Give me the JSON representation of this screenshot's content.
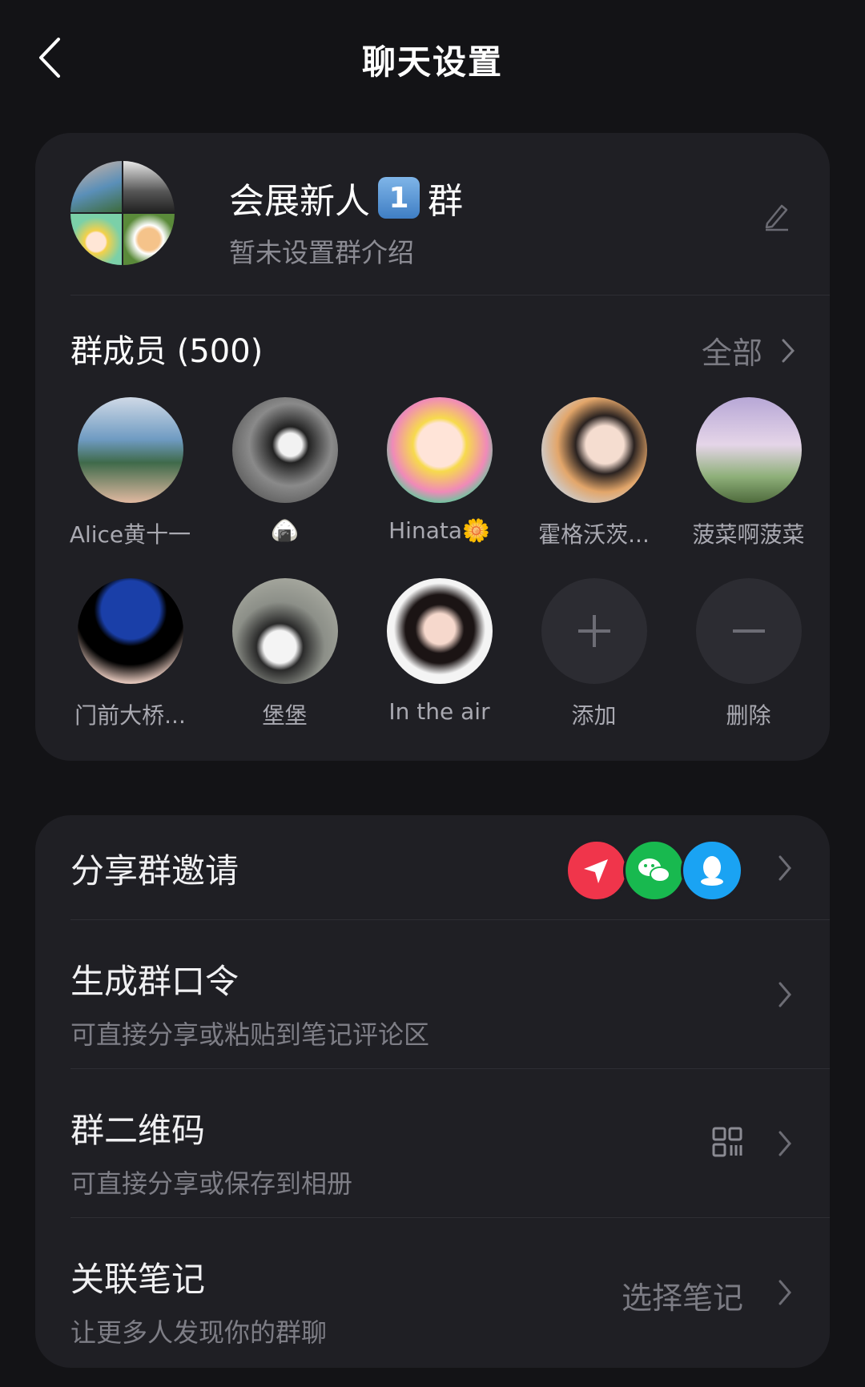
{
  "header": {
    "title": "聊天设置"
  },
  "group": {
    "name": "会展新人",
    "badge": "1",
    "name_suffix": "群",
    "intro": "暂未设置群介绍"
  },
  "members": {
    "title": "群成员 (500)",
    "all_label": "全部",
    "items": [
      {
        "name": "Alice黄十一"
      },
      {
        "name": "🍙"
      },
      {
        "name": "Hinata🌼"
      },
      {
        "name": "霍格沃茨..."
      },
      {
        "name": "菠菜啊菠菜"
      },
      {
        "name": "门前大桥..."
      },
      {
        "name": "堡堡"
      },
      {
        "name": "In the air"
      }
    ],
    "add_label": "添加",
    "remove_label": "删除"
  },
  "options": {
    "share": {
      "title": "分享群邀请"
    },
    "token": {
      "title": "生成群口令",
      "subtitle": "可直接分享或粘贴到笔记评论区"
    },
    "qrcode": {
      "title": "群二维码",
      "subtitle": "可直接分享或保存到相册"
    },
    "note": {
      "title": "关联笔记",
      "subtitle": "让更多人发现你的群聊",
      "action": "选择笔记"
    }
  },
  "colors": {
    "background": "#131316",
    "card": "#1f1f24",
    "share_red": "#f0354b",
    "share_green": "#18b94f",
    "share_blue": "#1aa3f3"
  }
}
